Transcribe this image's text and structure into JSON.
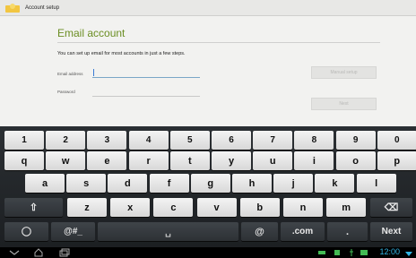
{
  "titlebar": {
    "title": "Account setup"
  },
  "main": {
    "heading": "Email account",
    "intro": "You can set up email for most accounts in just a few steps.",
    "email_label": "Email address",
    "email_value": "",
    "password_label": "Password",
    "password_value": "",
    "manual_setup_label": "Manual setup",
    "next_label": "Next"
  },
  "keyboard": {
    "row1": [
      "1",
      "2",
      "3",
      "4",
      "5",
      "6",
      "7",
      "8",
      "9",
      "0"
    ],
    "row2": [
      "q",
      "w",
      "e",
      "r",
      "t",
      "y",
      "u",
      "i",
      "o",
      "p"
    ],
    "row3": [
      "a",
      "s",
      "d",
      "f",
      "g",
      "h",
      "j",
      "k",
      "l"
    ],
    "row4": [
      "z",
      "x",
      "c",
      "v",
      "b",
      "n",
      "m"
    ],
    "symbols_label": "@#_",
    "at_label": "@",
    "com_label": ".com",
    "period_label": ".",
    "next_label": "Next"
  },
  "statusbar": {
    "time": "12:00"
  },
  "colors": {
    "accent": "#6b8e23",
    "clock": "#33b5e5",
    "keyboard_bg": "#2b2f33"
  }
}
